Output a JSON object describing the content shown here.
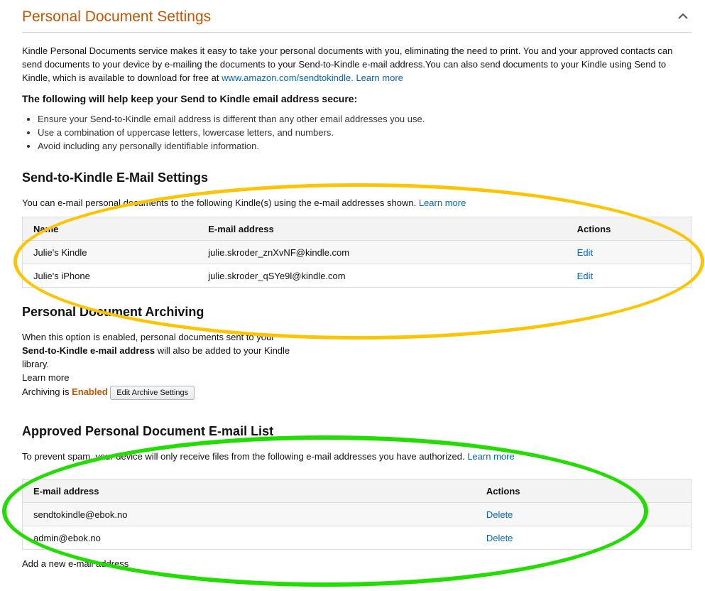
{
  "header": {
    "title": "Personal Document Settings"
  },
  "intro": {
    "text": "Kindle Personal Documents service makes it easy to take your personal documents with you, eliminating the need to print. You and your approved contacts can send documents to your device by e-mailing the documents to your Send-to-Kindle e-mail address.You can also send documents to your Kindle using Send to Kindle, which is available to download for free at ",
    "link_url_text": "www.amazon.com/sendtokindle.",
    "learn_more": "Learn more"
  },
  "security": {
    "heading": "The following will help keep your Send to Kindle email address secure:",
    "tips": [
      "Ensure your Send-to-Kindle email address is different than any other email addresses you use.",
      "Use a combination of uppercase letters, lowercase letters, and numbers.",
      "Avoid including any personally identifiable information."
    ]
  },
  "send_to_kindle": {
    "heading": "Send-to-Kindle E-Mail Settings",
    "desc": "You can e-mail personal documents to the following Kindle(s) using the e-mail addresses shown.",
    "learn_more": "Learn more",
    "columns": [
      "Name",
      "E-mail address",
      "Actions"
    ],
    "rows": [
      {
        "name": "Julie's Kindle",
        "email": "julie.skroder_znXvNF@kindle.com",
        "action": "Edit"
      },
      {
        "name": "Julie's iPhone",
        "email": "julie.skroder_qSYe9l@kindle.com",
        "action": "Edit"
      }
    ]
  },
  "archiving": {
    "heading": "Personal Document Archiving",
    "line1": "When this option is enabled, personal documents sent to your",
    "line2_bold": "Send-to-Kindle e-mail address",
    "line2_rest": " will also be added to your Kindle",
    "line3": "library.",
    "learn_more": "Learn more",
    "status_label": "Archiving is ",
    "status_value": "Enabled",
    "edit_button": "Edit Archive Settings"
  },
  "approved": {
    "heading": "Approved Personal Document E-mail List",
    "desc": "To prevent spam, your device will only receive files from the following e-mail addresses you have authorized.",
    "learn_more": "Learn more",
    "columns": [
      "E-mail address",
      "Actions"
    ],
    "rows": [
      {
        "email": "sendtokindle@ebok.no",
        "action": "Delete"
      },
      {
        "email": "admin@ebok.no",
        "action": "Delete"
      }
    ],
    "add_link": "Add a new e-mail address"
  },
  "annotations": {
    "yellow": "#ffc400",
    "green": "#22dd00"
  },
  "icons": {
    "collapse": "chevron-up-icon"
  }
}
